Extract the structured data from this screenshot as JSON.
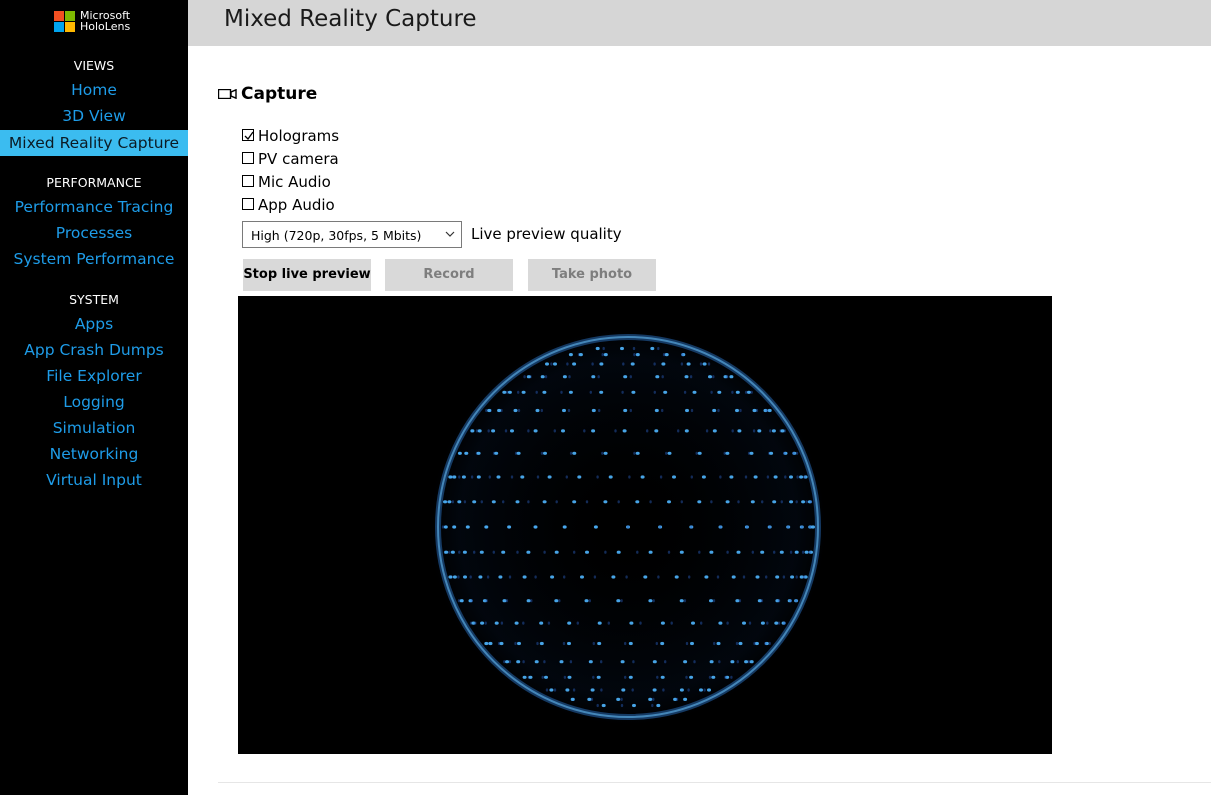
{
  "sidebar": {
    "logo_text": "Microsoft\nHoloLens",
    "sections": [
      {
        "title": "VIEWS",
        "items": [
          "Home",
          "3D View",
          "Mixed Reality Capture"
        ]
      },
      {
        "title": "PERFORMANCE",
        "items": [
          "Performance Tracing",
          "Processes",
          "System Performance"
        ]
      },
      {
        "title": "SYSTEM",
        "items": [
          "Apps",
          "App Crash Dumps",
          "File Explorer",
          "Logging",
          "Simulation",
          "Networking",
          "Virtual Input"
        ]
      }
    ],
    "active_item": "Mixed Reality Capture"
  },
  "header": {
    "title": "Mixed Reality Capture"
  },
  "capture": {
    "section_title": "Capture",
    "section_icon": "video-camera-icon",
    "options": [
      {
        "label": "Holograms",
        "checked": true
      },
      {
        "label": "PV camera",
        "checked": false
      },
      {
        "label": "Mic Audio",
        "checked": false
      },
      {
        "label": "App Audio",
        "checked": false
      }
    ],
    "quality_select": {
      "value": "High (720p, 30fps, 5 Mbits)",
      "label": "Live preview quality"
    },
    "buttons": {
      "stop_preview": "Stop live preview",
      "record": "Record",
      "take_photo": "Take photo"
    }
  },
  "colors": {
    "sidebar_bg": "#000000",
    "nav_link": "#1e9ce8",
    "nav_active_bg": "#3bbcf0",
    "header_bg": "#d6d6d6",
    "button_bg": "#d9d9d9",
    "hologram_blue": "#3aa0ff"
  }
}
